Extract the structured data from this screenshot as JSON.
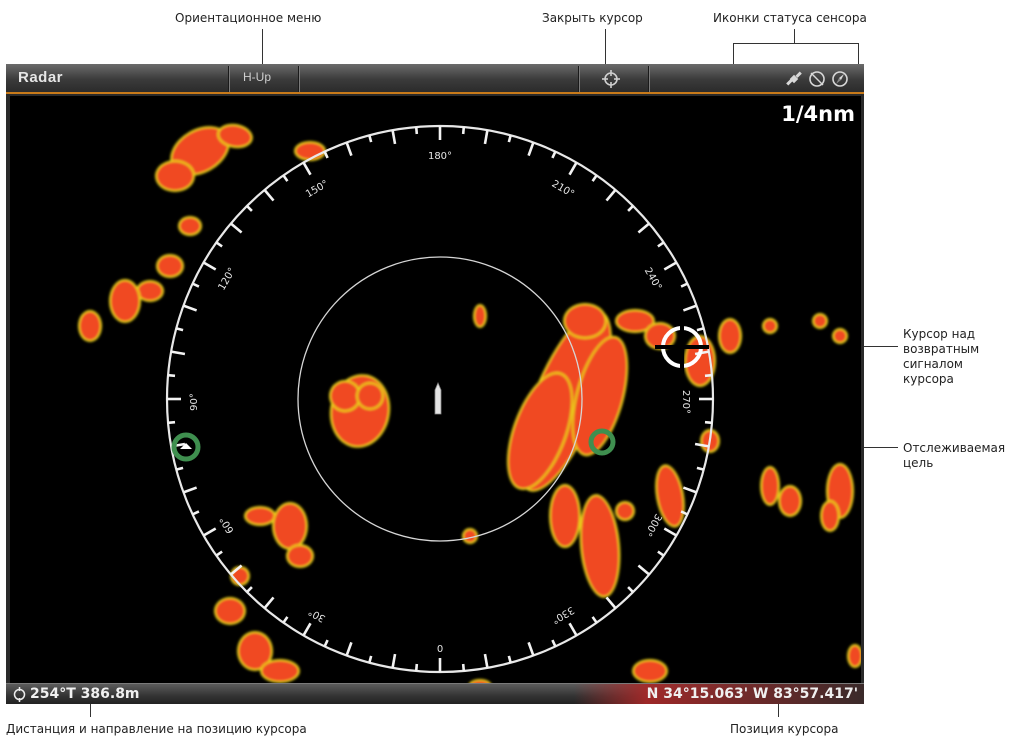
{
  "callouts": {
    "orientation_menu": "Ориентационное меню",
    "close_cursor": "Закрыть курсор",
    "sensor_status_icons": "Иконки статуса сенсора",
    "cursor_over_return": "Курсор над возвратным сигналом курсора",
    "tracked_target": "Отслеживаемая цель",
    "distance_bearing": "Дистанция и направление на позицию курсора",
    "cursor_position": "Позиция курсора"
  },
  "topbar": {
    "title": "Radar",
    "orientation_mode": "H-Up",
    "close_cursor_icon": "crosshair-icon",
    "status_icons": [
      "satellite-icon",
      "heading-sensor-icon",
      "compass-icon"
    ]
  },
  "display": {
    "range": "1/4nm",
    "bearing_labels": [
      "180°",
      "150°",
      "210°",
      "120°",
      "240°",
      "90°",
      "270°",
      "60°",
      "300°",
      "30°",
      "330°",
      "0"
    ]
  },
  "bottombar": {
    "cursor_bearing_distance": "254°T  386.8m",
    "cursor_position": "N 34°15.063' W 83°57.417'"
  },
  "colors": {
    "return_strong": "#f04a20",
    "return_weak": "#e8d21a",
    "accent_orange": "#c87a1a",
    "tracked_target": "#3f8f4f"
  }
}
